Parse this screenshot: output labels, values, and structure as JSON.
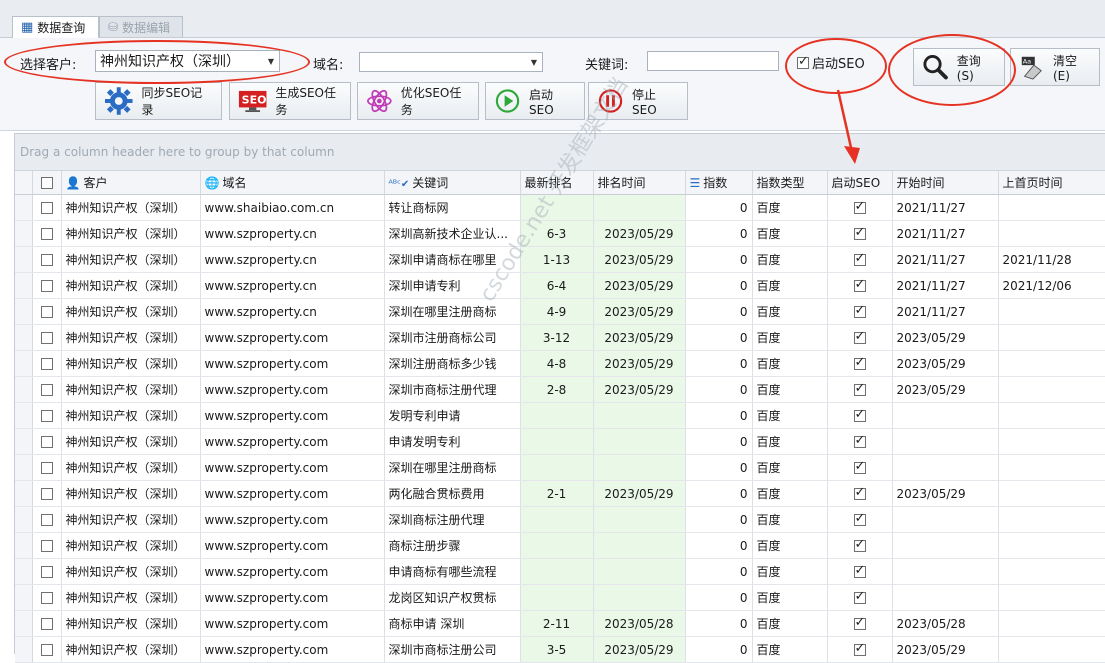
{
  "tabs": {
    "query": "数据查询",
    "edit": "数据编辑"
  },
  "filter": {
    "customer_label": "选择客户:",
    "customer_value": "神州知识产权（深圳）",
    "domain_label": "域名:",
    "domain_value": "",
    "keyword_label": "关键词:",
    "keyword_value": "",
    "start_seo_label": "启动SEO",
    "start_seo_checked": true
  },
  "buttons": {
    "query": "查询(S)",
    "clear": "清空(E)",
    "sync": "同步SEO记录",
    "generate": "生成SEO任务",
    "optimize": "优化SEO任务",
    "start": "启动SEO",
    "stop": "停止SEO"
  },
  "grid": {
    "group_hint": "Drag a column header here to group by that column",
    "columns": {
      "customer": "客户",
      "domain": "域名",
      "keyword": "关键词",
      "rank": "最新排名",
      "rank_time": "排名时间",
      "index": "指数",
      "index_type": "指数类型",
      "start_seo": "启动SEO",
      "start_time": "开始时间",
      "first_page_time": "上首页时间"
    },
    "rows": [
      {
        "customer": "神州知识产权（深圳）",
        "domain": "www.shaibiao.com.cn",
        "keyword": "转让商标网",
        "rank": "",
        "rank_time": "",
        "index": "0",
        "index_type": "百度",
        "seo": true,
        "start": "2021/11/27",
        "first": ""
      },
      {
        "customer": "神州知识产权（深圳）",
        "domain": "www.szproperty.cn",
        "keyword": "深圳高新技术企业认...",
        "rank": "6-3",
        "rank_time": "2023/05/29",
        "index": "0",
        "index_type": "百度",
        "seo": true,
        "start": "2021/11/27",
        "first": ""
      },
      {
        "customer": "神州知识产权（深圳）",
        "domain": "www.szproperty.cn",
        "keyword": "深圳申请商标在哪里",
        "rank": "1-13",
        "rank_time": "2023/05/29",
        "index": "0",
        "index_type": "百度",
        "seo": true,
        "start": "2021/11/27",
        "first": "2021/11/28"
      },
      {
        "customer": "神州知识产权（深圳）",
        "domain": "www.szproperty.cn",
        "keyword": "深圳申请专利",
        "rank": "6-4",
        "rank_time": "2023/05/29",
        "index": "0",
        "index_type": "百度",
        "seo": true,
        "start": "2021/11/27",
        "first": "2021/12/06"
      },
      {
        "customer": "神州知识产权（深圳）",
        "domain": "www.szproperty.cn",
        "keyword": "深圳在哪里注册商标",
        "rank": "4-9",
        "rank_time": "2023/05/29",
        "index": "0",
        "index_type": "百度",
        "seo": true,
        "start": "2021/11/27",
        "first": ""
      },
      {
        "customer": "神州知识产权（深圳）",
        "domain": "www.szproperty.com",
        "keyword": "深圳市注册商标公司",
        "rank": "3-12",
        "rank_time": "2023/05/29",
        "index": "0",
        "index_type": "百度",
        "seo": true,
        "start": "2023/05/29",
        "first": ""
      },
      {
        "customer": "神州知识产权（深圳）",
        "domain": "www.szproperty.com",
        "keyword": "深圳注册商标多少钱",
        "rank": "4-8",
        "rank_time": "2023/05/29",
        "index": "0",
        "index_type": "百度",
        "seo": true,
        "start": "2023/05/29",
        "first": ""
      },
      {
        "customer": "神州知识产权（深圳）",
        "domain": "www.szproperty.com",
        "keyword": "深圳市商标注册代理",
        "rank": "2-8",
        "rank_time": "2023/05/29",
        "index": "0",
        "index_type": "百度",
        "seo": true,
        "start": "2023/05/29",
        "first": ""
      },
      {
        "customer": "神州知识产权（深圳）",
        "domain": "www.szproperty.com",
        "keyword": "发明专利申请",
        "rank": "",
        "rank_time": "",
        "index": "0",
        "index_type": "百度",
        "seo": true,
        "start": "",
        "first": ""
      },
      {
        "customer": "神州知识产权（深圳）",
        "domain": "www.szproperty.com",
        "keyword": "申请发明专利",
        "rank": "",
        "rank_time": "",
        "index": "0",
        "index_type": "百度",
        "seo": true,
        "start": "",
        "first": ""
      },
      {
        "customer": "神州知识产权（深圳）",
        "domain": "www.szproperty.com",
        "keyword": "深圳在哪里注册商标",
        "rank": "",
        "rank_time": "",
        "index": "0",
        "index_type": "百度",
        "seo": true,
        "start": "",
        "first": ""
      },
      {
        "customer": "神州知识产权（深圳）",
        "domain": "www.szproperty.com",
        "keyword": "两化融合贯标费用",
        "rank": "2-1",
        "rank_time": "2023/05/29",
        "index": "0",
        "index_type": "百度",
        "seo": true,
        "start": "2023/05/29",
        "first": ""
      },
      {
        "customer": "神州知识产权（深圳）",
        "domain": "www.szproperty.com",
        "keyword": "深圳商标注册代理",
        "rank": "",
        "rank_time": "",
        "index": "0",
        "index_type": "百度",
        "seo": true,
        "start": "",
        "first": ""
      },
      {
        "customer": "神州知识产权（深圳）",
        "domain": "www.szproperty.com",
        "keyword": "商标注册步骤",
        "rank": "",
        "rank_time": "",
        "index": "0",
        "index_type": "百度",
        "seo": true,
        "start": "",
        "first": ""
      },
      {
        "customer": "神州知识产权（深圳）",
        "domain": "www.szproperty.com",
        "keyword": "申请商标有哪些流程",
        "rank": "",
        "rank_time": "",
        "index": "0",
        "index_type": "百度",
        "seo": true,
        "start": "",
        "first": ""
      },
      {
        "customer": "神州知识产权（深圳）",
        "domain": "www.szproperty.com",
        "keyword": "龙岗区知识产权贯标",
        "rank": "",
        "rank_time": "",
        "index": "0",
        "index_type": "百度",
        "seo": true,
        "start": "",
        "first": ""
      },
      {
        "customer": "神州知识产权（深圳）",
        "domain": "www.szproperty.com",
        "keyword": "商标申请 深圳",
        "rank": "2-11",
        "rank_time": "2023/05/28",
        "index": "0",
        "index_type": "百度",
        "seo": true,
        "start": "2023/05/28",
        "first": ""
      },
      {
        "customer": "神州知识产权（深圳）",
        "domain": "www.szproperty.com",
        "keyword": "深圳市商标注册公司",
        "rank": "3-5",
        "rank_time": "2023/05/29",
        "index": "0",
        "index_type": "百度",
        "seo": true,
        "start": "2023/05/29",
        "first": ""
      }
    ]
  },
  "watermark": "cscode.net 开发框架文档",
  "colors": {
    "annotation": "#e53222",
    "green_cell": "#e9f8e7",
    "accent_blue": "#1e5fa8"
  }
}
